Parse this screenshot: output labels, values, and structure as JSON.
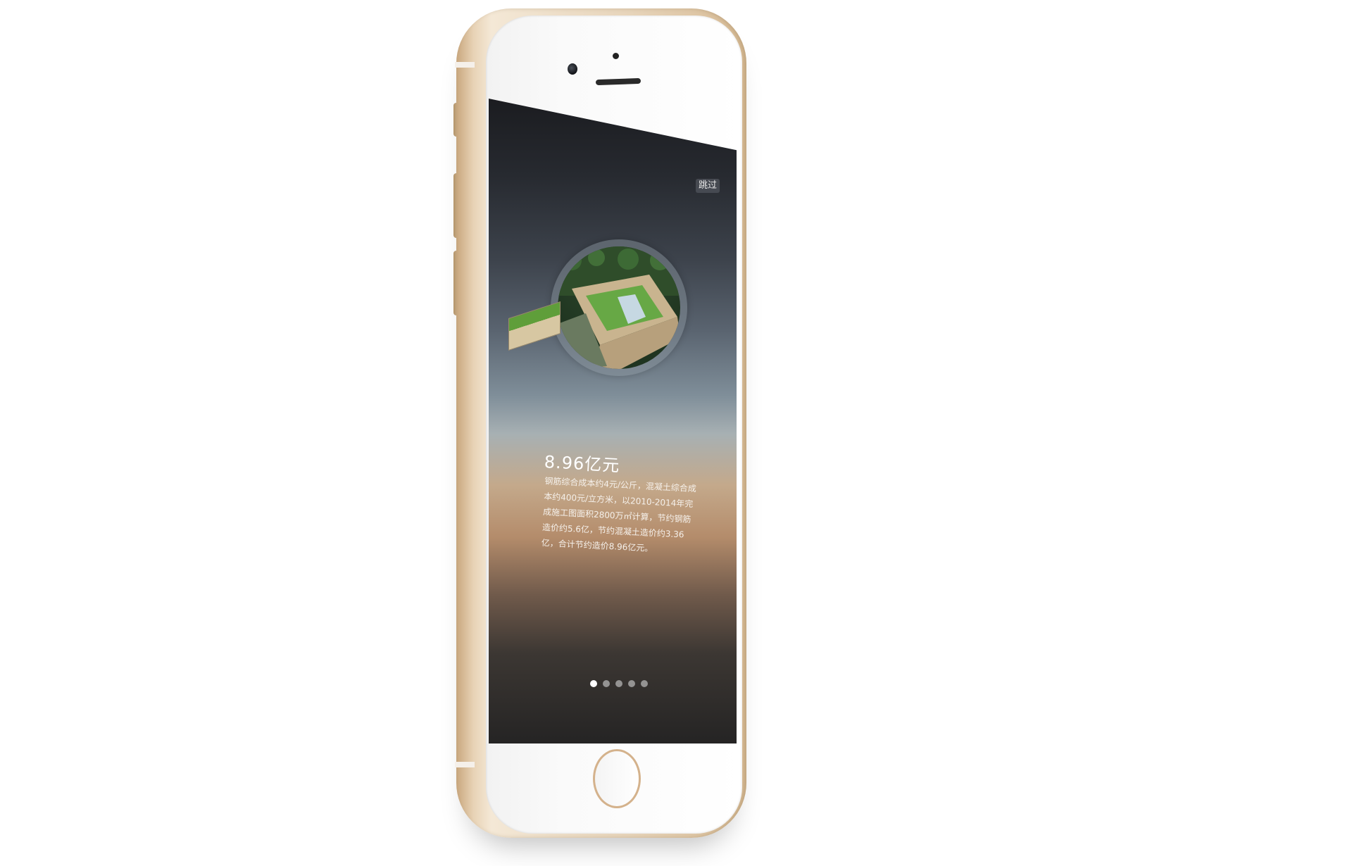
{
  "screen": {
    "skip_label": "跳过",
    "title": "8.96亿元",
    "description": "钢筋综合成本约4元/公斤，混凝土综合成本约400元/立方米，以2010-2014年完成施工图面积2800万㎡计算，节约钢筋造价约5.6亿，节约混凝土造价约3.36亿，合计节约造价8.96亿元。",
    "pager": {
      "total": 5,
      "active_index": 0
    }
  },
  "colors": {
    "phone_gold": "#e8d3b6",
    "home_ring": "#d4b28c",
    "active_dot": "#ffffff",
    "inactive_dot": "#bebebe"
  },
  "icons": {
    "camera": "camera-icon",
    "speaker": "speaker-icon",
    "home_button": "home-button"
  }
}
